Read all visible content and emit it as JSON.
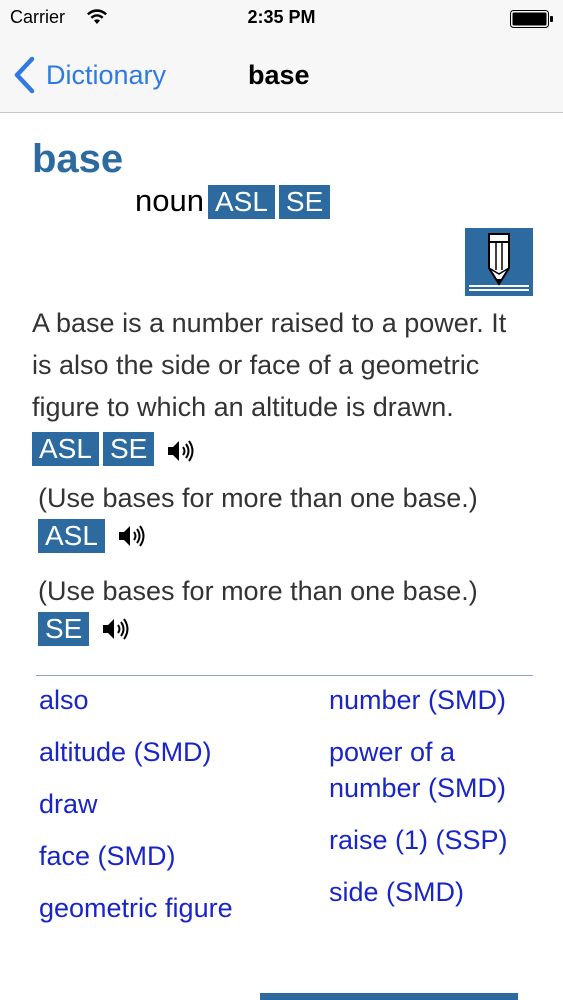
{
  "status_bar": {
    "carrier": "Carrier",
    "time": "2:35 PM"
  },
  "nav": {
    "back_label": "Dictionary",
    "title": "base"
  },
  "entry": {
    "headword": "base",
    "part_of_speech": "noun",
    "pos_tags": [
      "ASL",
      "SE"
    ],
    "definition": "A base is a number raised to a power. It is also the side or face of a geometric figure to which an altitude is drawn.",
    "definition_tags": [
      "ASL",
      "SE"
    ],
    "notes": [
      {
        "text": "(Use bases for more than one base.)",
        "tag": "ASL"
      },
      {
        "text": "(Use bases for more than one base.)",
        "tag": "SE"
      }
    ]
  },
  "related_links": {
    "left": [
      "also",
      "altitude (SMD)",
      "draw",
      "face (SMD)",
      "geometric figure"
    ],
    "right": [
      "number (SMD)",
      "power of a",
      "number (SMD)",
      "raise (1) (SSP)",
      "side (SMD)"
    ]
  },
  "colors": {
    "accent": "#2c6aa0",
    "link": "#1a25c8",
    "nav_link": "#2f7ae0"
  }
}
